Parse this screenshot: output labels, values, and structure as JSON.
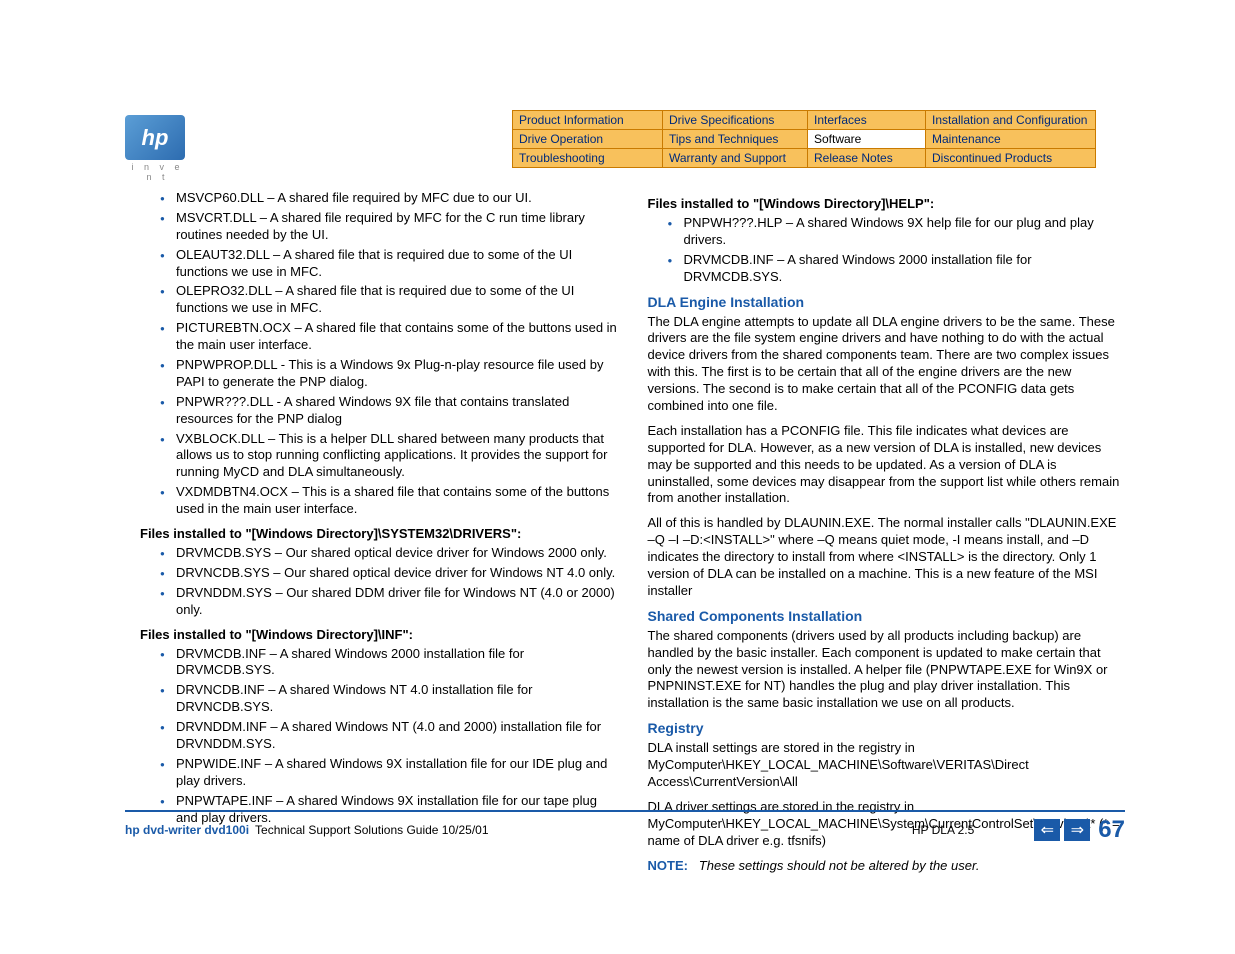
{
  "logo": {
    "text": "hp",
    "tagline": "i n v e n t"
  },
  "nav": {
    "row1": [
      "Product Information",
      "Drive Specifications",
      "Interfaces",
      "Installation and Configuration"
    ],
    "row2": [
      "Drive Operation",
      "Tips and Techniques",
      "Software",
      "Maintenance"
    ],
    "row3": [
      "Troubleshooting",
      "Warranty and Support",
      "Release Notes",
      "Discontinued Products"
    ],
    "active": "Software"
  },
  "left": {
    "list1": [
      "MSVCP60.DLL – A shared file required by MFC due to our UI.",
      "MSVCRT.DLL – A shared file required by MFC for the C run time library routines needed by the UI.",
      "OLEAUT32.DLL – A shared file that is required due to some of the UI functions we use in MFC.",
      "OLEPRO32.DLL – A shared file that is required due to some of the UI functions we use in MFC.",
      "PICTUREBTN.OCX – A shared file that contains some of the buttons used in the main user interface.",
      "PNPWPROP.DLL - This is a Windows 9x Plug-n-play resource file used by PAPI to generate the PNP dialog.",
      "PNPWR???.DLL - A shared Windows 9X file that contains translated resources for the PNP dialog",
      "VXBLOCK.DLL – This is a helper DLL shared between many products that allows us to stop running conflicting applications. It provides the support for running MyCD and DLA simultaneously.",
      "VXDMDBTN4.OCX – This is a shared file that contains some of the buttons used in the main user interface."
    ],
    "head2": "Files installed to \"[Windows Directory]\\SYSTEM32\\DRIVERS\":",
    "list2": [
      "DRVMCDB.SYS – Our shared optical device driver for Windows 2000 only.",
      "DRVNCDB.SYS – Our shared optical device driver for Windows NT 4.0 only.",
      "DRVNDDM.SYS – Our shared DDM driver file for Windows NT (4.0 or 2000) only."
    ],
    "head3": "Files installed to \"[Windows Directory]\\INF\":",
    "list3": [
      "DRVMCDB.INF – A shared Windows 2000 installation file for DRVMCDB.SYS.",
      "DRVNCDB.INF – A shared Windows NT 4.0 installation file for DRVNCDB.SYS.",
      "DRVNDDM.INF – A shared Windows NT (4.0 and 2000) installation file for DRVNDDM.SYS.",
      "PNPWIDE.INF – A shared Windows 9X installation file for our IDE plug and play drivers.",
      "PNPWTAPE.INF – A shared Windows 9X installation file for our tape plug and play drivers."
    ]
  },
  "right": {
    "head1": "Files installed to \"[Windows Directory]\\HELP\":",
    "list1": [
      "PNPWH???.HLP – A shared Windows 9X help file for our plug and play drivers.",
      "DRVMCDB.INF – A shared Windows 2000 installation file for DRVMCDB.SYS."
    ],
    "h_dla": "DLA Engine Installation",
    "p_dla1": "The DLA engine attempts to update all DLA engine drivers to be the same. These drivers are the file system engine drivers and have nothing to do with the actual device drivers from the shared components team. There are two complex issues with this. The first is to be certain that all of the engine drivers are the new versions. The second is to make certain that all of the PCONFIG data gets combined into one file.",
    "p_dla2": "Each installation has a PCONFIG file. This file indicates what devices are supported for DLA. However, as a new version of DLA is installed, new devices may be supported and this needs to be updated. As a version of DLA is uninstalled, some devices may disappear from the support list while others remain from another installation.",
    "p_dla3": "All of this is handled by DLAUNIN.EXE. The normal installer calls \"DLAUNIN.EXE –Q –I –D:<INSTALL>\" where –Q means quiet mode, -I means install, and –D indicates the directory to install from where <INSTALL> is the directory. Only 1 version of DLA can be installed on a machine.  This is a new feature of the MSI installer",
    "h_shared": "Shared Components Installation",
    "p_shared": "The shared components (drivers used by all products including backup) are handled by the basic installer. Each component is updated to make certain that only the newest version is installed. A helper file (PNPWTAPE.EXE for Win9X or PNPNINST.EXE for NT) handles the plug and play driver installation. This installation is the same basic installation we use on all products.",
    "h_reg": "Registry",
    "p_reg1": "DLA install settings are stored in the registry in MyComputer\\HKEY_LOCAL_MACHINE\\Software\\VERITAS\\Direct Access\\CurrentVersion\\All",
    "p_reg2": "DLA driver settings are stored in the registry in MyComputer\\HKEY_LOCAL_MACHINE\\System\\CurrentControlSet\\Services\\*   (* = name of DLA driver e.g. tfsnifs)",
    "note_label": "NOTE:",
    "note_text": "These settings should not be altered by the user."
  },
  "footer": {
    "title": "hp dvd-writer  dvd100i",
    "sub": "Technical Support Solutions Guide 10/25/01",
    "section": "HP DLA 2.5",
    "page": "67"
  }
}
